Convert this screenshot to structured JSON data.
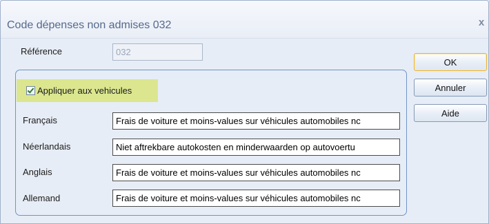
{
  "window": {
    "title": "Code dépenses non admises 032",
    "close_label": "x"
  },
  "reference": {
    "label": "Référence",
    "value": "032",
    "disabled": true
  },
  "group": {
    "checkbox": {
      "label": "Appliquer aux vehicules",
      "checked": true
    },
    "fields": [
      {
        "label": "Français",
        "value": "Frais de voiture et moins-values sur véhicules automobiles nc"
      },
      {
        "label": "Néerlandais",
        "value": "Niet aftrekbare autokosten en minderwaarden op autovoertu"
      },
      {
        "label": "Anglais",
        "value": "Frais de voiture et moins-values sur véhicules automobiles nc"
      },
      {
        "label": "Allemand",
        "value": "Frais de voiture et moins-values sur véhicules automobiles nc"
      }
    ]
  },
  "buttons": {
    "ok": "OK",
    "cancel": "Annuler",
    "help": "Aide"
  },
  "icons": {
    "close": "close-icon",
    "checkbox": "check-icon"
  },
  "colors": {
    "window_bg": "#e7edf6",
    "group_border": "#6f92c6",
    "highlight": "#dbe68f",
    "default_button_border": "#e3b34c",
    "title_text": "#55698c"
  }
}
